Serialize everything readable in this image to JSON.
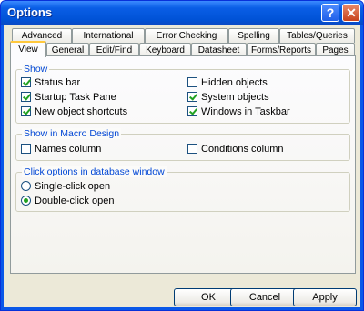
{
  "window": {
    "title": "Options",
    "help_glyph": "?",
    "close_glyph": "✕"
  },
  "tabs_row1": [
    "Advanced",
    "International",
    "Error Checking",
    "Spelling",
    "Tables/Queries"
  ],
  "tabs_row2": [
    "View",
    "General",
    "Edit/Find",
    "Keyboard",
    "Datasheet",
    "Forms/Reports",
    "Pages"
  ],
  "active_tab": "View",
  "show": {
    "label": "Show",
    "items": [
      {
        "label": "Status bar",
        "checked": true
      },
      {
        "label": "Startup Task Pane",
        "checked": true
      },
      {
        "label": "New object shortcuts",
        "checked": true
      },
      {
        "label": "Hidden objects",
        "checked": false
      },
      {
        "label": "System objects",
        "checked": true
      },
      {
        "label": "Windows in Taskbar",
        "checked": true
      }
    ]
  },
  "macro": {
    "label": "Show in Macro Design",
    "items": [
      {
        "label": "Names column",
        "checked": false
      },
      {
        "label": "Conditions column",
        "checked": false
      }
    ]
  },
  "click": {
    "label": "Click options in database window",
    "items": [
      {
        "label": "Single-click open",
        "selected": false
      },
      {
        "label": "Double-click open",
        "selected": true
      }
    ]
  },
  "buttons": {
    "ok": "OK",
    "cancel": "Cancel",
    "apply": "Apply"
  }
}
